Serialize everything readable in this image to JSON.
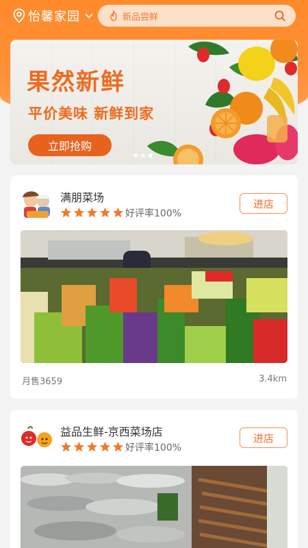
{
  "header": {
    "location": "怡馨家园",
    "search_placeholder": "新品尝鲜"
  },
  "banner": {
    "title": "果然新鲜",
    "subtitle": "平价美味 新鲜到家",
    "button": "立即抢购"
  },
  "stores": [
    {
      "name": "满朋菜场",
      "rating_label": "好评率100%",
      "stars": 5,
      "enter_label": "进店",
      "monthly_sales": "月售3659",
      "distance": "3.4km"
    },
    {
      "name": "益品生鲜-京西菜场店",
      "rating_label": "好评率100%",
      "stars": 5,
      "enter_label": "进店"
    }
  ],
  "colors": {
    "accent": "#ff8a2a",
    "button": "#e8621e",
    "star": "#f07a2a"
  },
  "icons": [
    "location-pin-icon",
    "chevron-down-icon",
    "flame-icon",
    "search-icon",
    "star-icon"
  ]
}
